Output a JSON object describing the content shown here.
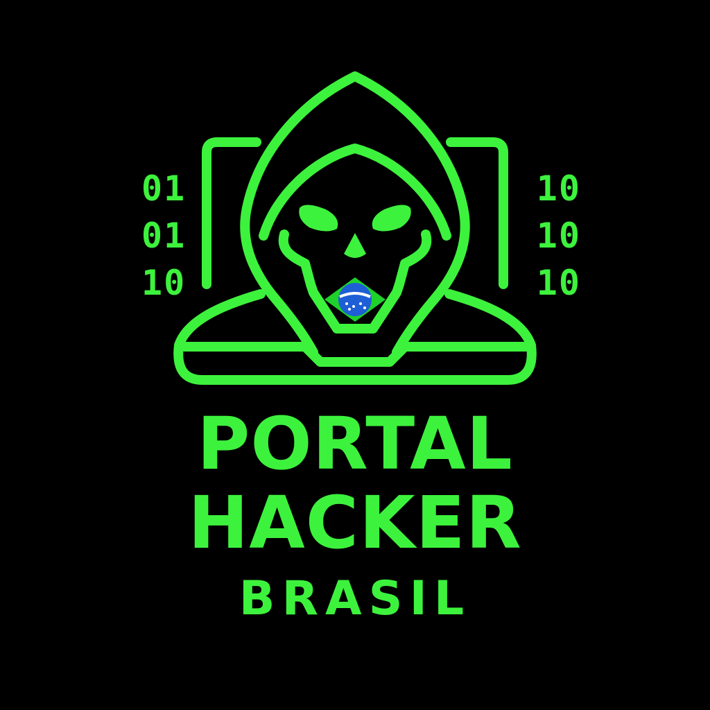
{
  "brand": {
    "line1": "PORTAL",
    "line2": "HACKER",
    "line3": "BRASIL"
  },
  "binary_left": [
    "01",
    "01",
    "10"
  ],
  "binary_right": [
    "10",
    "10",
    "10"
  ],
  "colors": {
    "background": "#000000",
    "neon_green": "#3df23d",
    "flag_green": "#1fd12b",
    "flag_blue": "#1e5fd6"
  },
  "icons": {
    "emblem": "hooded-skull-hacker-icon",
    "flag": "brazil-flag-icon"
  }
}
